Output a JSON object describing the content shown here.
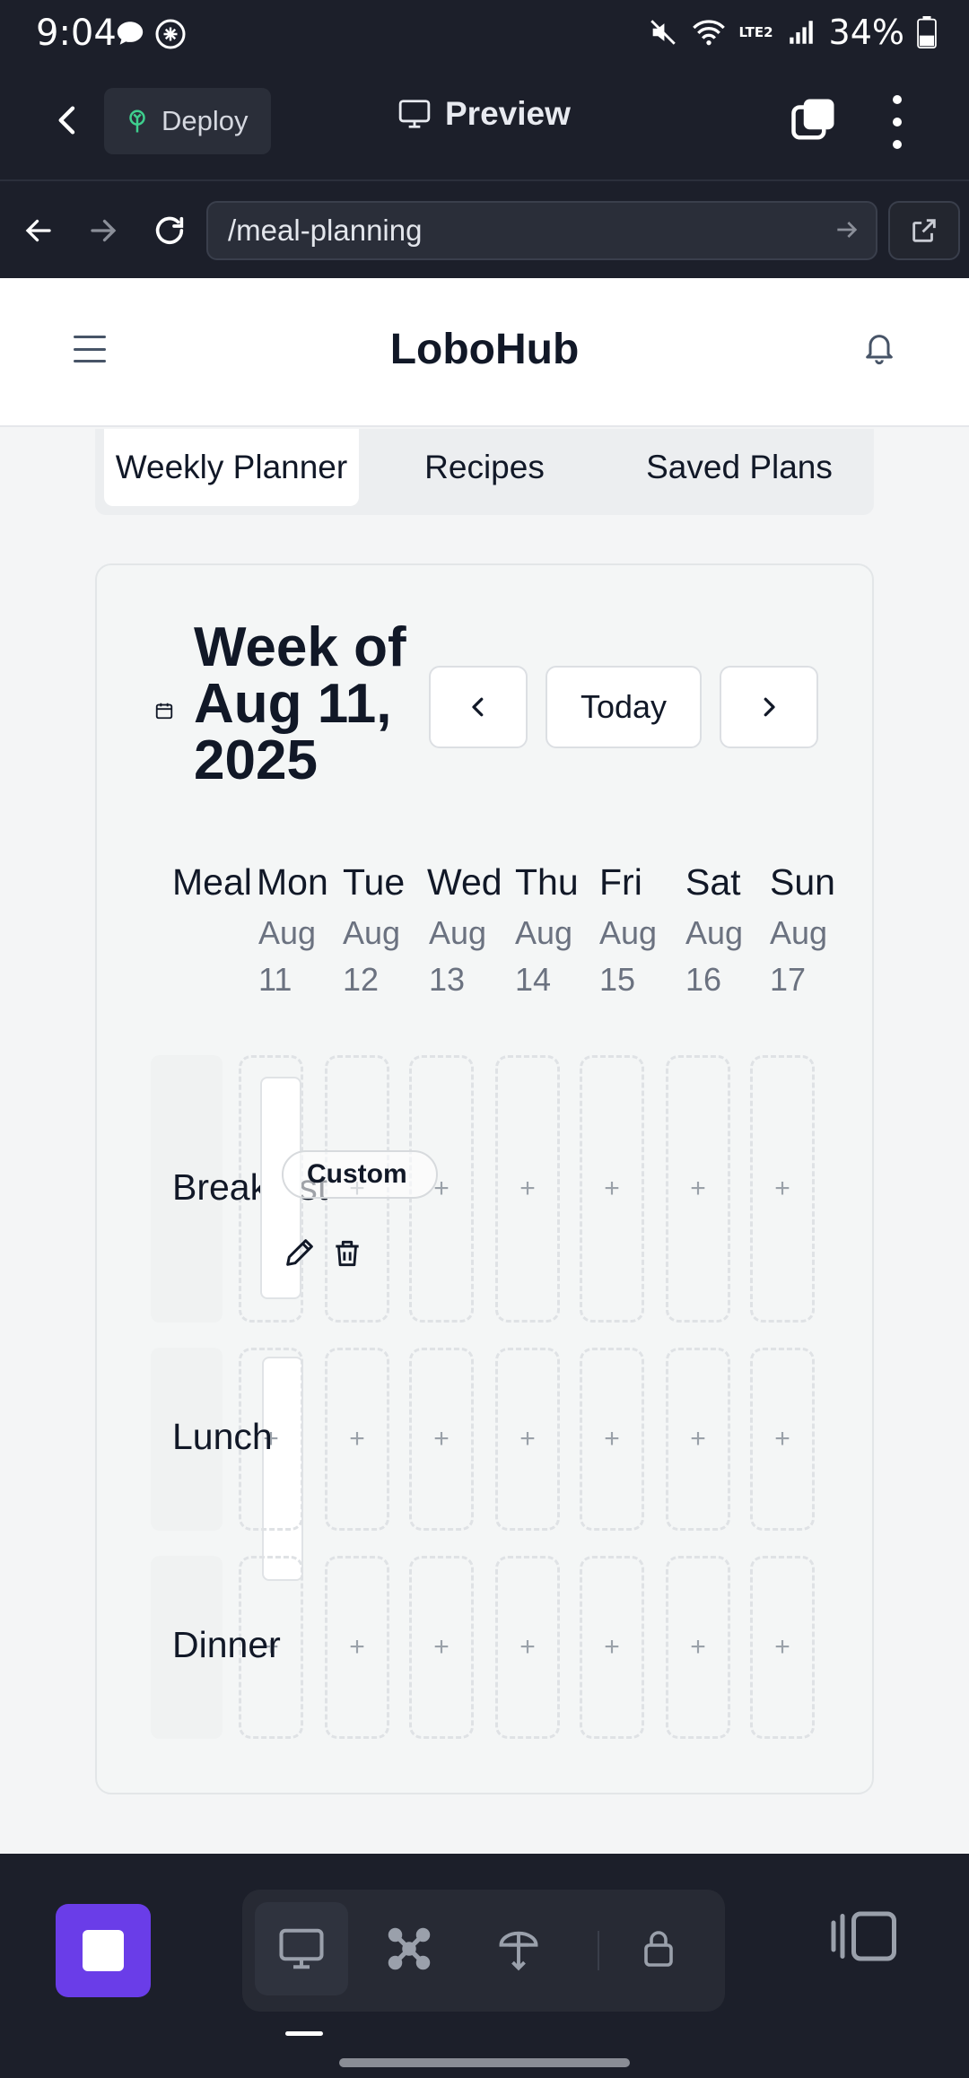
{
  "status": {
    "time": "9:04",
    "battery": "34%",
    "network": "LTE2"
  },
  "topbar": {
    "deploy_label": "Deploy",
    "preview_label": "Preview"
  },
  "urlbar": {
    "url": "/meal-planning"
  },
  "app": {
    "brand": "LoboHub",
    "tabs": [
      {
        "label": "Weekly Planner",
        "active": true
      },
      {
        "label": "Recipes",
        "active": false
      },
      {
        "label": "Saved Plans",
        "active": false
      }
    ]
  },
  "planner": {
    "week_title": "Week of Aug 11, 2025",
    "prev_label": "‹",
    "today_label": "Today",
    "next_label": "›",
    "meal_header": "Meal",
    "days": [
      {
        "day": "Mon",
        "month": "Aug",
        "date": "11"
      },
      {
        "day": "Tue",
        "month": "Aug",
        "date": "12"
      },
      {
        "day": "Wed",
        "month": "Aug",
        "date": "13"
      },
      {
        "day": "Thu",
        "month": "Aug",
        "date": "14"
      },
      {
        "day": "Fri",
        "month": "Aug",
        "date": "15"
      },
      {
        "day": "Sat",
        "month": "Aug",
        "date": "16"
      },
      {
        "day": "Sun",
        "month": "Aug",
        "date": "17"
      }
    ],
    "meals": [
      "Breakfast",
      "Lunch",
      "Dinner"
    ],
    "add_symbol": "+",
    "scheduled_item": {
      "label": "Custom",
      "meal": "Breakfast",
      "day": "Mon"
    }
  },
  "colors": {
    "accent": "#6a3de8",
    "chrome_bg": "#1c1f2a",
    "deploy_icon": "#3ecf8e"
  }
}
